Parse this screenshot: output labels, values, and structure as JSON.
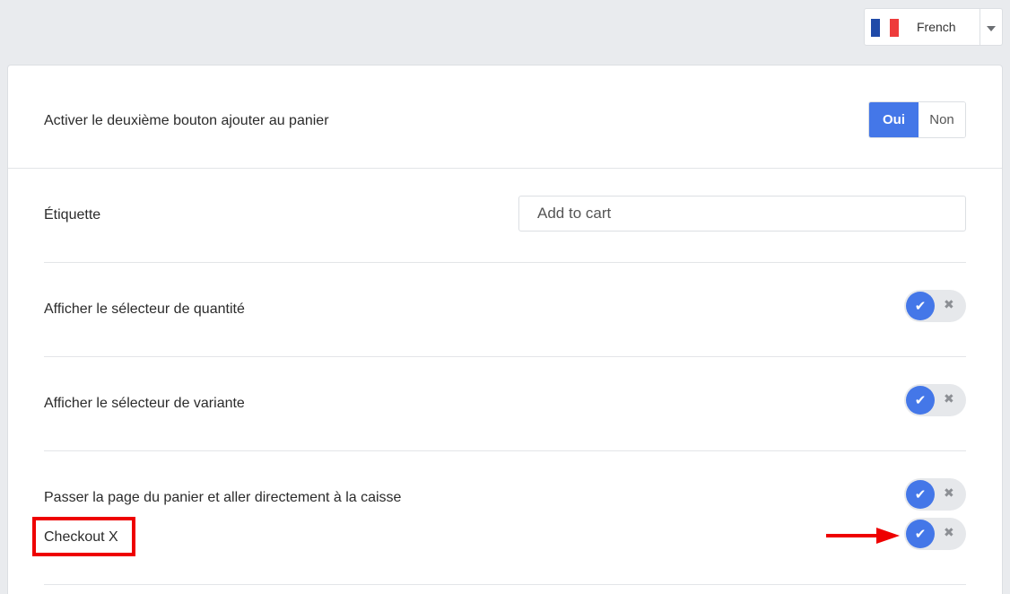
{
  "language": {
    "selected": "French",
    "flag_colors": [
      "#1f4aa8",
      "#ffffff",
      "#ee3b3b"
    ]
  },
  "settings": {
    "second_button": {
      "label": "Activer le deuxième bouton ajouter au panier",
      "yes_label": "Oui",
      "no_label": "Non",
      "selected": "Oui"
    },
    "label_field": {
      "label": "Étiquette",
      "value": "Add to cart"
    },
    "quantity_selector": {
      "label": "Afficher le sélecteur de quantité",
      "enabled": true
    },
    "variant_selector": {
      "label": "Afficher le sélecteur de variante",
      "enabled": true
    },
    "skip_cart": {
      "label": "Passer la page du panier et aller directement à la caisse",
      "enabled": true
    },
    "checkout_x": {
      "label": "Checkout X",
      "enabled": true
    }
  },
  "toggle_icons": {
    "on": "✔",
    "off": "✖"
  },
  "colors": {
    "accent": "#4477e8",
    "highlight": "#ee0000",
    "background": "#e9ebee"
  }
}
